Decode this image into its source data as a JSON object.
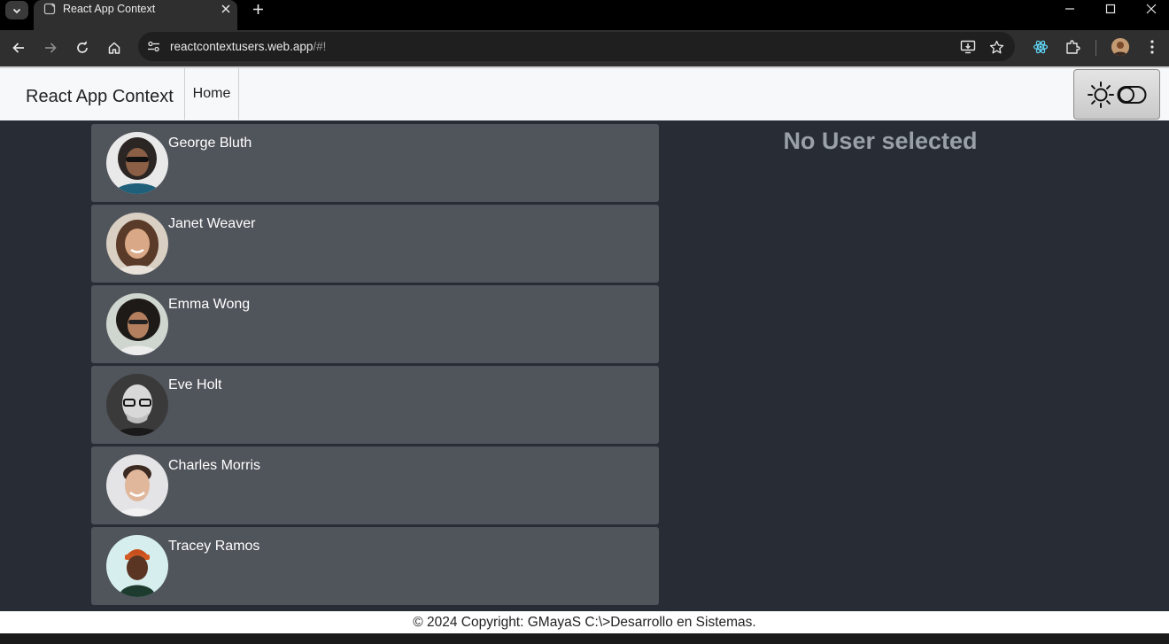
{
  "browser": {
    "tab_title": "React App Context",
    "url_host": "reactcontextusers.web.app",
    "url_path": "/#!"
  },
  "app": {
    "brand": "React App Context",
    "nav_home": "Home",
    "empty_state": "No User selected",
    "footer": "© 2024 Copyright: GMayaS C:\\>Desarrollo en Sistemas."
  },
  "users": [
    {
      "name": "George Bluth"
    },
    {
      "name": "Janet Weaver"
    },
    {
      "name": "Emma Wong"
    },
    {
      "name": "Eve Holt"
    },
    {
      "name": "Charles Morris"
    },
    {
      "name": "Tracey Ramos"
    }
  ],
  "colors": {
    "page_bg": "#282c34",
    "card_bg": "#50545b",
    "navbar_bg": "#f7f8f9",
    "empty_state_text": "#9aa0a8"
  }
}
